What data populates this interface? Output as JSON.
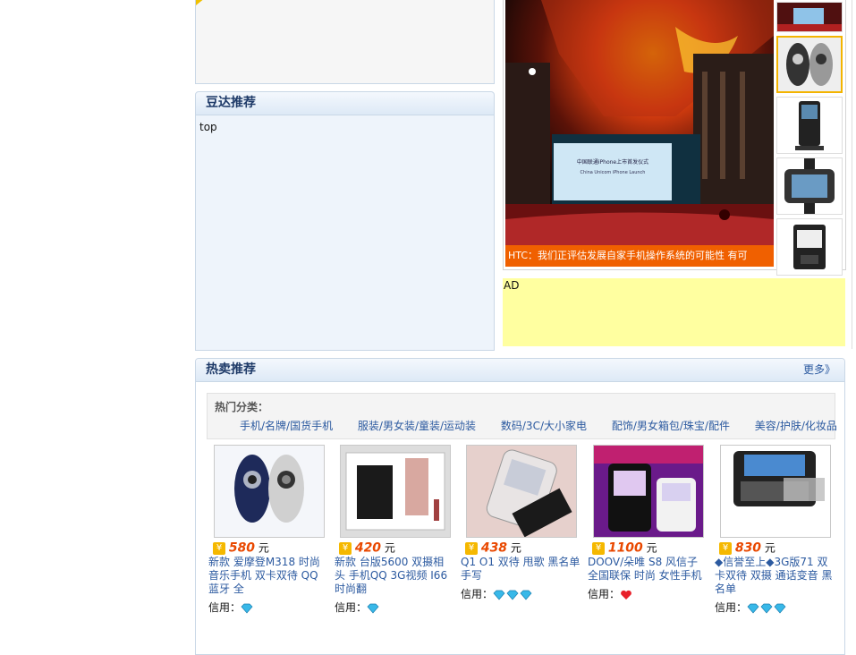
{
  "recommend": {
    "title": "豆达推荐",
    "body": "top"
  },
  "slideshow": {
    "caption": "HTC：我们正评估发展自家手机操作系统的可能性 有可",
    "screen_text_1": "中国联通iPhone上市首发仪式",
    "screen_text_2": "China Unicom iPhone Launch"
  },
  "ad": {
    "label": "AD"
  },
  "hot": {
    "title": "热卖推荐",
    "more": "更多》",
    "categories_title": "热门分类：",
    "categories": [
      "手机/名牌/国货手机",
      "服装/男女装/童装/运动装",
      "数码/3C/大小家电",
      "配饰/男女箱包/珠宝/配件",
      "美容/护肤/化妆品"
    ],
    "currency_unit": "元",
    "credit_label": "信用：",
    "products": [
      {
        "price": "580",
        "title": "新款 爱摩登M318 时尚音乐手机 双卡双待 QQ蓝牙 全",
        "credit_icons": "diamond",
        "credit_count": 1
      },
      {
        "price": "420",
        "title": "新款 台版5600 双摄相头 手机QQ 3G视频 I66时尚翻",
        "credit_icons": "diamond",
        "credit_count": 1
      },
      {
        "price": "438",
        "title": "Q1 O1 双待 甩歌 黑名单 手写",
        "credit_icons": "diamond",
        "credit_count": 3
      },
      {
        "price": "1100",
        "title": "DOOV/朵唯 S8 风信子全国联保 时尚 女性手机",
        "credit_icons": "heart",
        "credit_count": 1
      },
      {
        "price": "830",
        "title": "◆信誉至上◆3G版71 双卡双待 双摄 通话变音 黑名单",
        "credit_icons": "diamond",
        "credit_count": 3
      }
    ]
  },
  "colors": {
    "link": "#2c5aa0",
    "price": "#e94800",
    "caption_bg": "#f06000",
    "ad_bg": "#ffffa0",
    "accent": "#f3b400"
  }
}
